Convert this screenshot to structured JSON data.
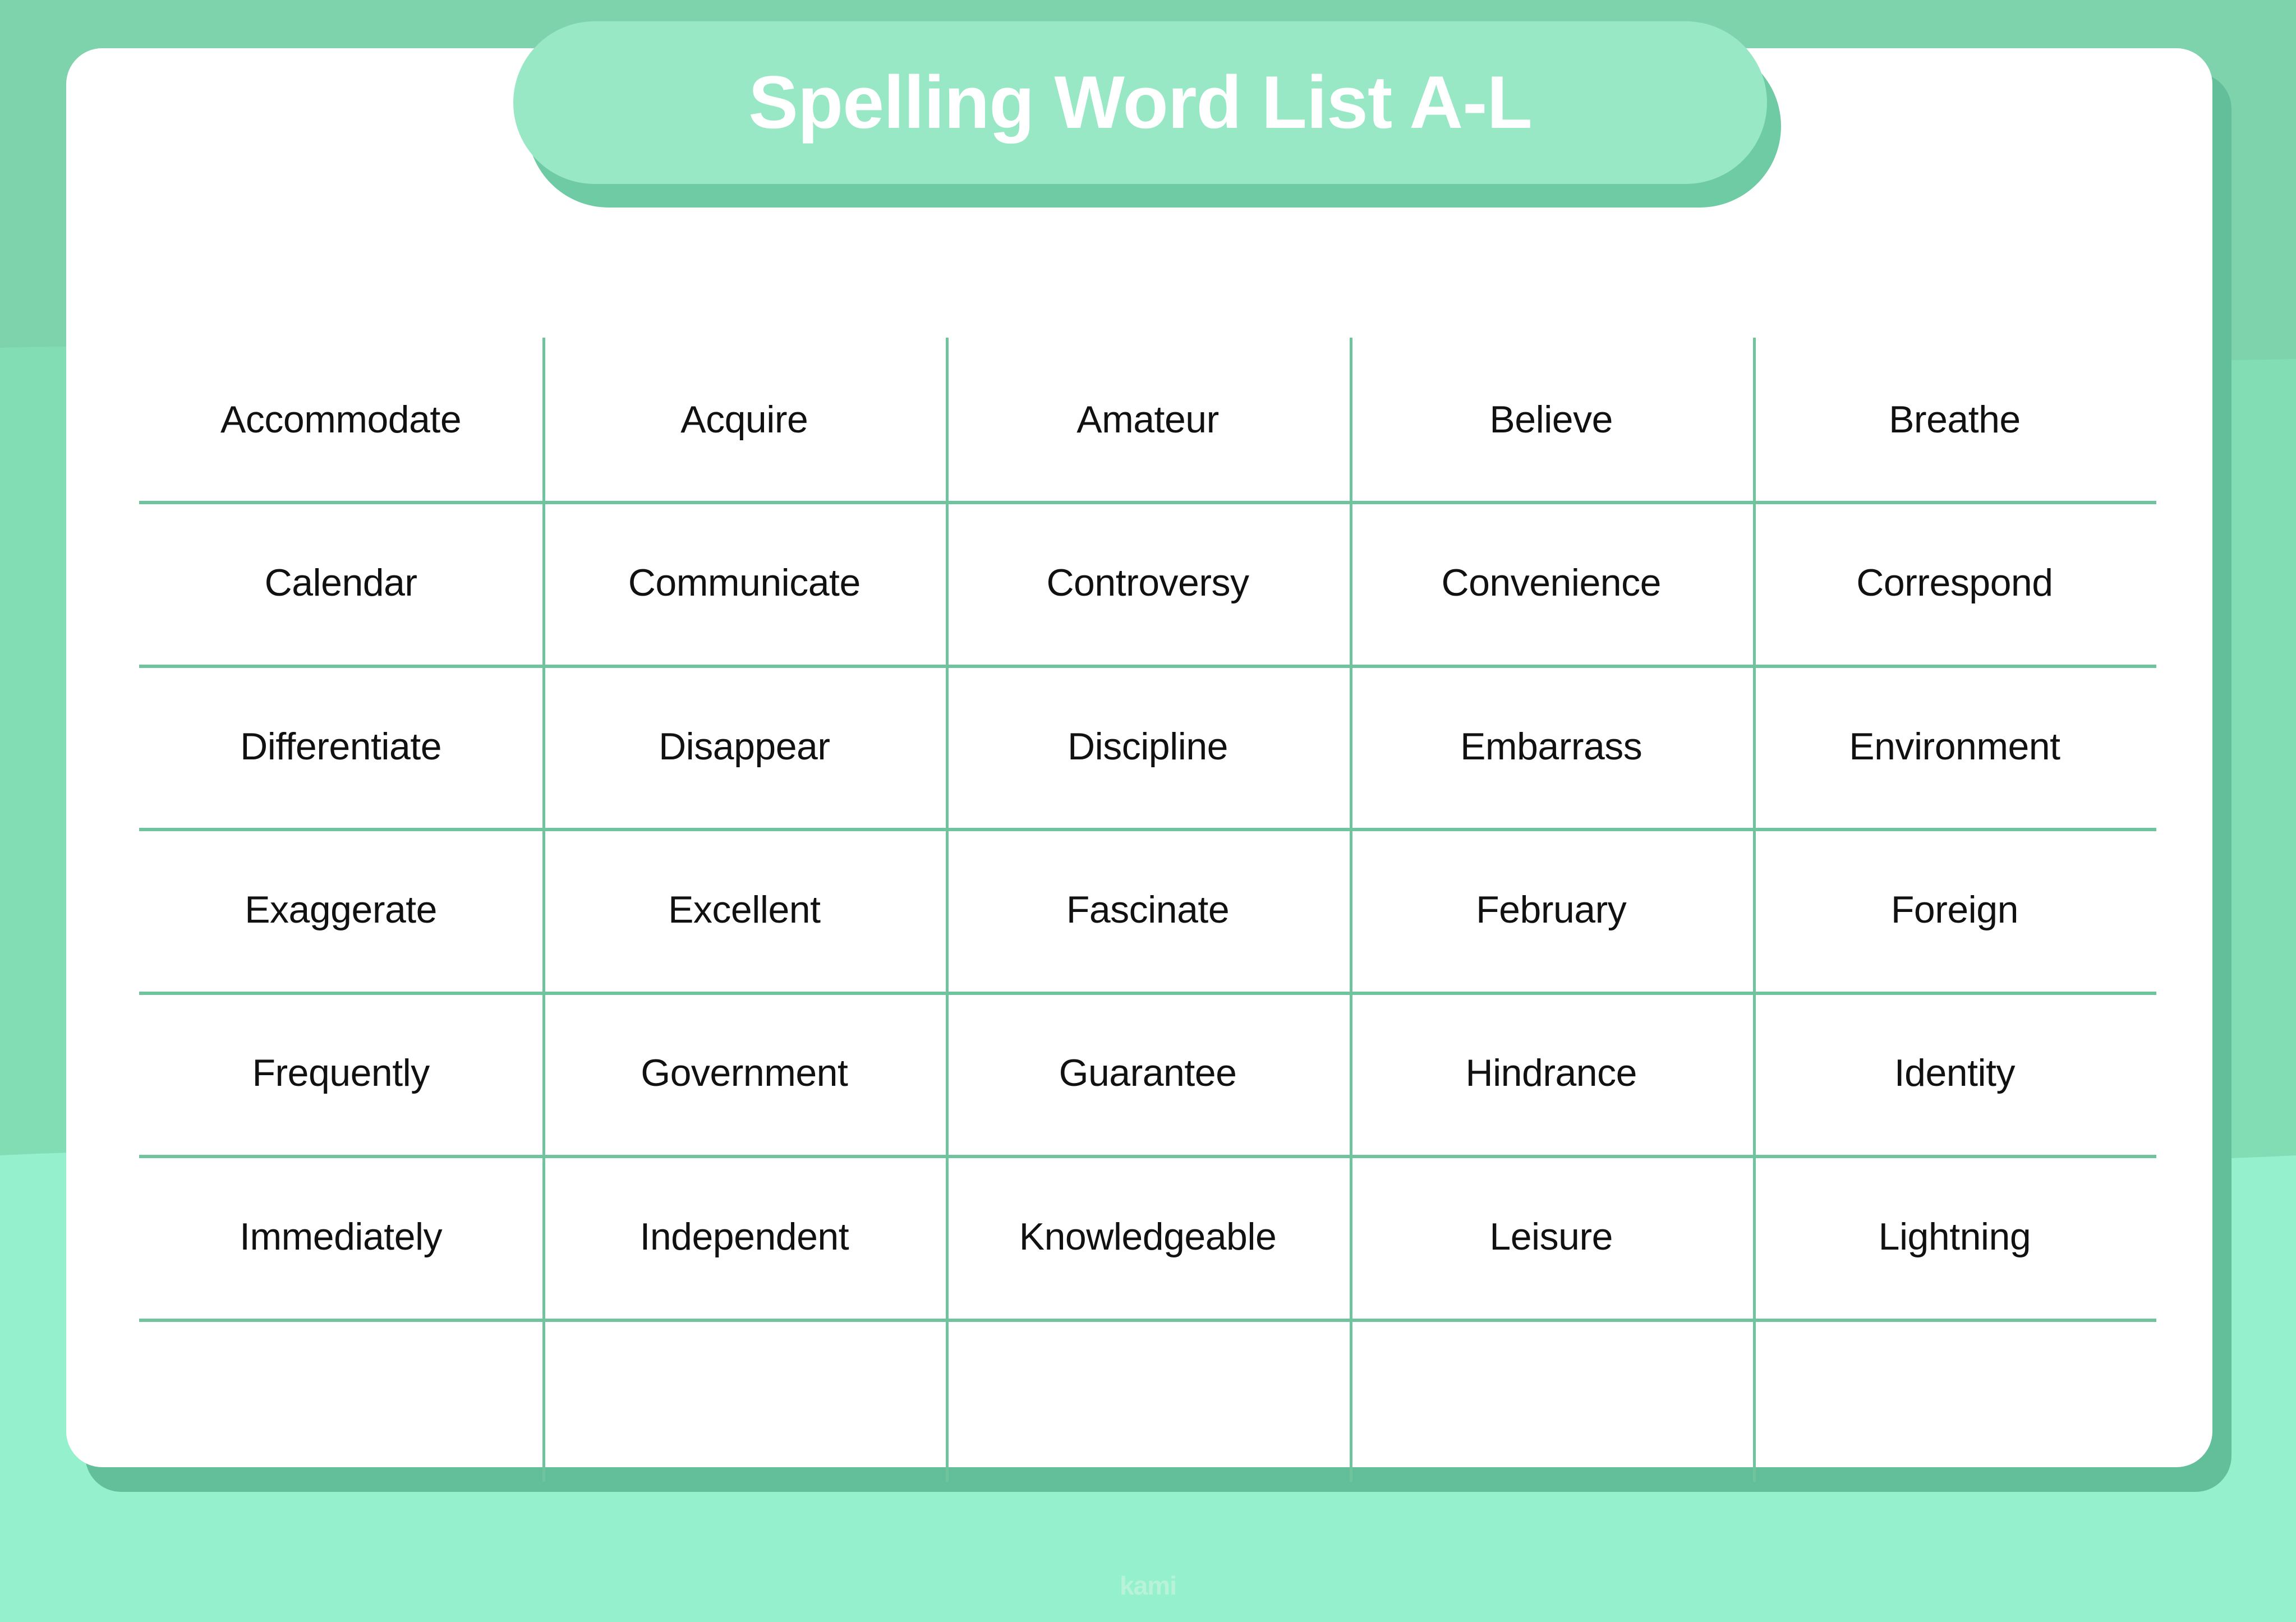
{
  "page": {
    "title": "Spelling Word List A-L",
    "footer_logo": "kami"
  },
  "colors": {
    "background_top": "#7ed3ac",
    "background_mid": "#82ddb5",
    "background_bottom": "#94f0cd",
    "card": "#ffffff",
    "card_shadow": "#63bf99",
    "banner": "#98e8c6",
    "banner_shadow": "#6fcba4",
    "grid_line": "#6fc49d",
    "word_text": "#111111",
    "title_text": "#ffffff",
    "logo_text": "#b8f3d9"
  },
  "table": {
    "columns": 5,
    "rows": 7,
    "words": [
      [
        "Accommodate",
        "Acquire",
        "Amateur",
        "Believe",
        "Breathe"
      ],
      [
        "Calendar",
        "Communicate",
        "Controversy",
        "Convenience",
        "Correspond"
      ],
      [
        "Differentiate",
        "Disappear",
        "Discipline",
        "Embarrass",
        "Environment"
      ],
      [
        "Exaggerate",
        "Excellent",
        "Fascinate",
        "February",
        "Foreign"
      ],
      [
        "Frequently",
        "Government",
        "Guarantee",
        "Hindrance",
        "Identity"
      ],
      [
        "Immediately",
        "Independent",
        "Knowledgeable",
        "Leisure",
        "Lightning"
      ],
      [
        "",
        "",
        "",
        "",
        ""
      ]
    ]
  }
}
